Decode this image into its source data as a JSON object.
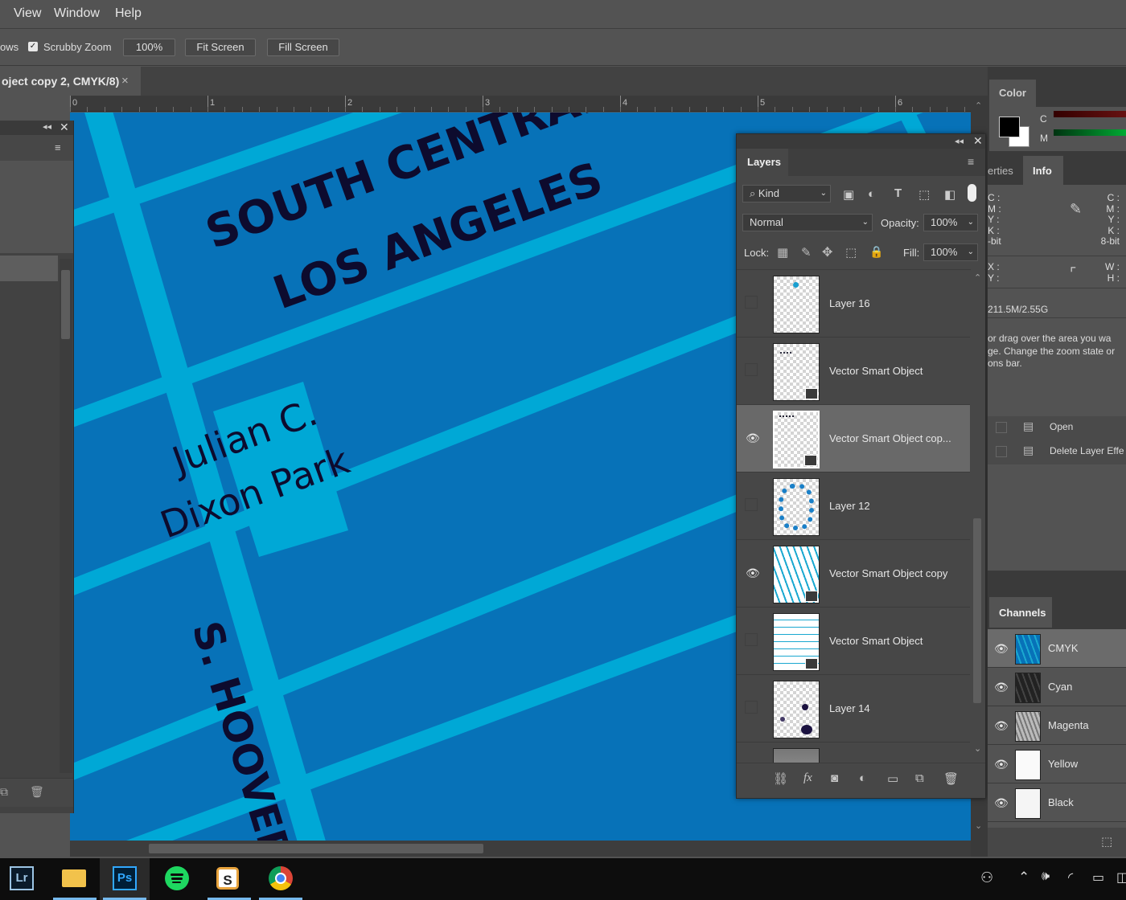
{
  "menubar": {
    "items": [
      "View",
      "Window",
      "Help"
    ]
  },
  "options_bar": {
    "partial_label": "ows",
    "scrubby_zoom_label": "Scrubby Zoom",
    "zoom_value": "100%",
    "fit_screen_label": "Fit Screen",
    "fill_screen_label": "Fill Screen"
  },
  "document": {
    "tab_title": "oject copy 2, CMYK/8)",
    "close_glyph": "×",
    "ruler_ticks": [
      "0",
      "1",
      "2",
      "3",
      "4",
      "5",
      "6"
    ]
  },
  "canvas": {
    "title_line1": "SOUTH CENTRAL",
    "title_line2": "LOS ANGELES",
    "park_line1": "Julian C.",
    "park_line2": "Dixon Park",
    "street_label": "S. HOOVER",
    "colors": {
      "background": "#0772b8",
      "streets": "#00a8d6",
      "text": "#0d0b2e"
    }
  },
  "layers_panel": {
    "tab_label": "Layers",
    "filter_kind": "Kind",
    "blend_mode": "Normal",
    "opacity_label": "Opacity:",
    "opacity_value": "100%",
    "lock_label": "Lock:",
    "fill_label": "Fill:",
    "fill_value": "100%",
    "layers": [
      {
        "name": "Layer 16",
        "visible": false,
        "selected": false
      },
      {
        "name": "Vector Smart Object",
        "visible": false,
        "selected": false
      },
      {
        "name": "Vector Smart Object cop...",
        "visible": true,
        "selected": true
      },
      {
        "name": "Layer 12",
        "visible": false,
        "selected": false
      },
      {
        "name": "Vector Smart Object copy",
        "visible": true,
        "selected": false
      },
      {
        "name": "Vector Smart Object",
        "visible": false,
        "selected": false
      },
      {
        "name": "Layer 14",
        "visible": false,
        "selected": false
      }
    ]
  },
  "right_dock": {
    "color_tab": "Color",
    "color_c": "C",
    "color_m": "M",
    "properties_tab": "erties",
    "info_tab": "Info",
    "info_left": [
      "C :",
      "M :",
      "Y :",
      "K :",
      "-bit"
    ],
    "info_right": [
      "C :",
      "M :",
      "Y :",
      "K :",
      "8-bit"
    ],
    "info_xy": [
      "X :",
      "Y :"
    ],
    "info_wh": [
      "W :",
      "H :"
    ],
    "doc_size": "211.5M/2.55G",
    "hint_lines": [
      "or drag over the area you wa",
      "ge. Change the zoom state or",
      "ons bar."
    ],
    "history_items": [
      "Open",
      "Delete Layer Effe"
    ],
    "channels_tab": "Channels",
    "channels": [
      "CMYK",
      "Cyan",
      "Magenta",
      "Yellow",
      "Black"
    ]
  },
  "taskbar": {
    "apps": [
      "Lr",
      "File Explorer",
      "Ps",
      "Spotify",
      "Slack",
      "Chrome"
    ],
    "lr_label": "Lr",
    "ps_label": "Ps"
  }
}
